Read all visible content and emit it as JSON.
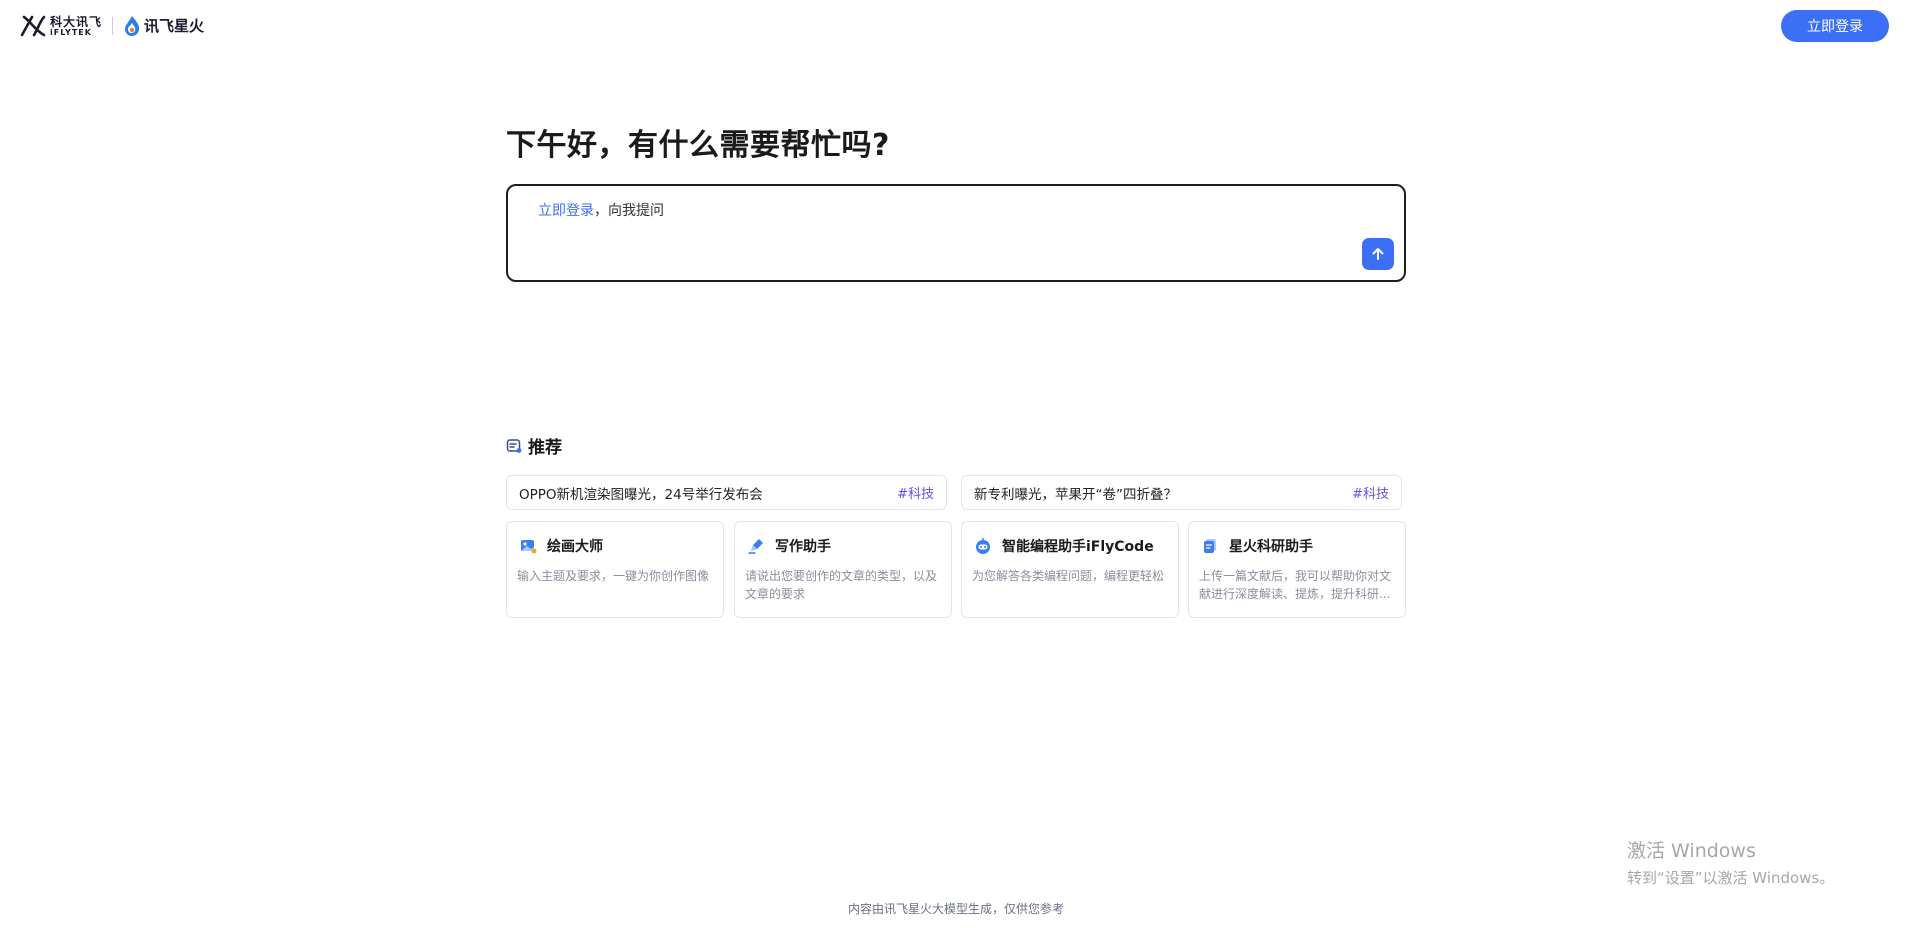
{
  "header": {
    "logo_iflytek_cn": "科大讯飞",
    "logo_iflytek_en": "iFLYTEK",
    "logo_spark_cn": "讯飞星火",
    "login_button": "立即登录"
  },
  "greeting": "下午好，有什么需要帮忙吗?",
  "ask_box": {
    "login_link": "立即登录",
    "prompt_suffix": "，向我提问"
  },
  "recommend": {
    "title": "推荐",
    "news": [
      {
        "title": "OPPO新机渲染图曝光，24号举行发布会",
        "tag": "#科技"
      },
      {
        "title": "新专利曝光，苹果开“卷”四折叠？",
        "tag": "#科技"
      }
    ],
    "assistants": [
      {
        "name": "绘画大师",
        "desc": "输入主题及要求，一键为你创作图像",
        "icon": "paint-icon"
      },
      {
        "name": "写作助手",
        "desc": "请说出您要创作的文章的类型，以及文章的要求",
        "icon": "pen-icon"
      },
      {
        "name": "智能编程助手iFlyCode",
        "desc": "为您解答各类编程问题，编程更轻松",
        "icon": "robot-icon"
      },
      {
        "name": "星火科研助手",
        "desc": "上传一篇文献后，我可以帮助你对文献进行深度解读、提炼，提升科研...",
        "icon": "document-icon"
      }
    ]
  },
  "footer": "内容由讯飞星火大模型生成，仅供您参考",
  "watermark": {
    "line1": "激活 Windows",
    "line2": "转到“设置”以激活 Windows。"
  },
  "colors": {
    "accent": "#3b6ff5",
    "tag": "#6b4de6"
  }
}
